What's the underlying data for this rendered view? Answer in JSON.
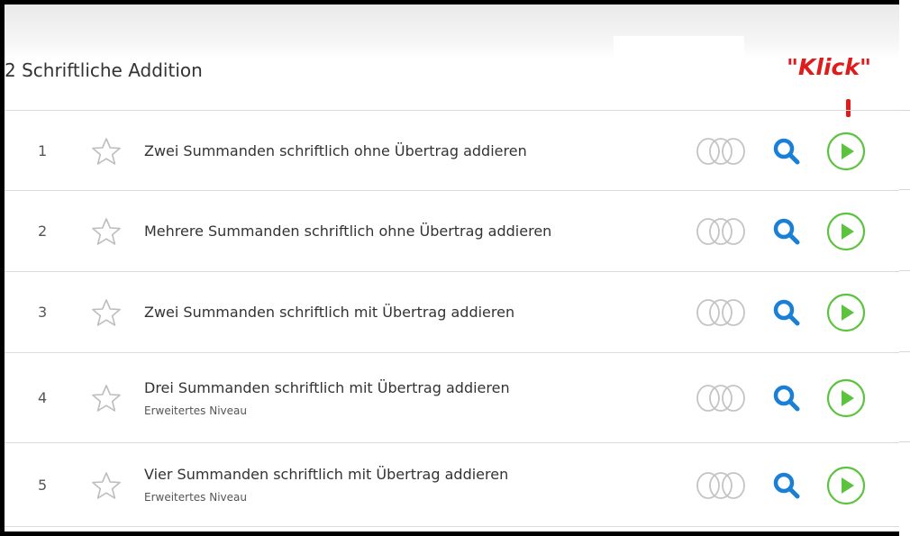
{
  "section": {
    "title": "2 Schriftliche Addition"
  },
  "annotation": {
    "klick_label": "\"Klick\""
  },
  "exercises": [
    {
      "number": "1",
      "title": "Zwei Summanden schriftlich ohne Übertrag addieren",
      "subtitle": ""
    },
    {
      "number": "2",
      "title": "Mehrere Summanden schriftlich ohne Übertrag addieren",
      "subtitle": ""
    },
    {
      "number": "3",
      "title": "Zwei Summanden schriftlich mit Übertrag addieren",
      "subtitle": ""
    },
    {
      "number": "4",
      "title": "Drei Summanden schriftlich mit Übertrag addieren",
      "subtitle": "Erweitertes Niveau"
    },
    {
      "number": "5",
      "title": "Vier Summanden schriftlich mit Übertrag addieren",
      "subtitle": "Erweitertes Niveau"
    }
  ],
  "icons": {
    "favorite": "star-outline-icon",
    "progress": "progress-rings-icon",
    "preview": "search-icon",
    "start": "play-icon"
  },
  "colors": {
    "search_blue": "#1a7fd6",
    "play_green": "#5cc33f",
    "annotation_red": "#e01b1b",
    "icon_gray": "#bdbdbd"
  }
}
